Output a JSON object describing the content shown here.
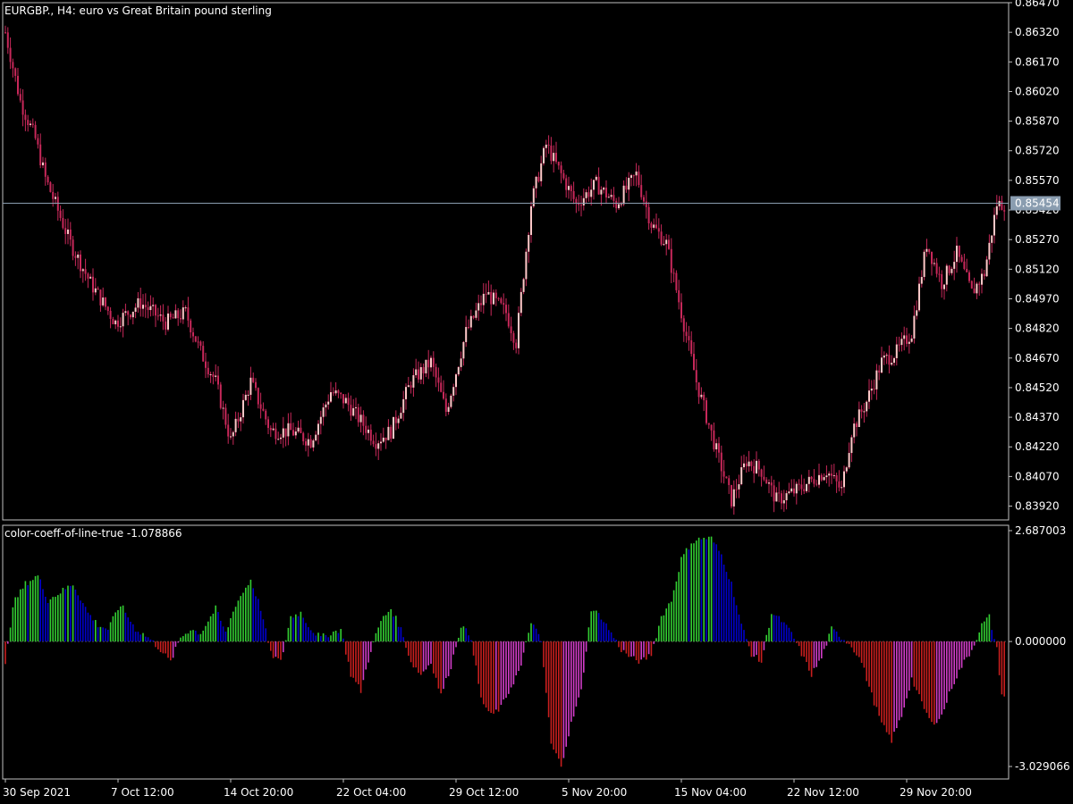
{
  "window": {
    "title": "EURGBP., H4:  euro vs Great Britain pound sterling",
    "indicator_label": "color-coeff-of-line-true -1.078866"
  },
  "colors": {
    "background": "#000000",
    "frame": "#c0c0c0",
    "bull_body": "#ffc8c8",
    "bear_body": "#c8285a",
    "wick": "#c8285a",
    "bid_line": "#8a9db0",
    "bid_label_bg": "#8a9db0",
    "hist_up_strong": "#32cd32",
    "hist_up_weak": "#0000cd",
    "hist_down_strong": "#c81e1e",
    "hist_down_weak": "#d23cc8"
  },
  "chart_data": [
    {
      "type": "candlestick",
      "symbol": "EURGBP.",
      "timeframe": "H4",
      "ylim": [
        0.8385,
        0.8647
      ],
      "y_ticks": [
        "0.86470",
        "0.86320",
        "0.86170",
        "0.86020",
        "0.85870",
        "0.85720",
        "0.85570",
        "0.85420",
        "0.85270",
        "0.85120",
        "0.84970",
        "0.84820",
        "0.84670",
        "0.84520",
        "0.84370",
        "0.84220",
        "0.84070",
        "0.83920"
      ],
      "current_price": "0.85454",
      "current_price_value": 0.85454,
      "close_anchors": [
        [
          0,
          0.8632
        ],
        [
          6,
          0.8597
        ],
        [
          12,
          0.8578
        ],
        [
          16,
          0.8558
        ],
        [
          20,
          0.8545
        ],
        [
          26,
          0.8525
        ],
        [
          34,
          0.8505
        ],
        [
          44,
          0.8485
        ],
        [
          54,
          0.8495
        ],
        [
          64,
          0.8485
        ],
        [
          72,
          0.849
        ],
        [
          78,
          0.847
        ],
        [
          84,
          0.8455
        ],
        [
          90,
          0.8425
        ],
        [
          98,
          0.8455
        ],
        [
          106,
          0.843
        ],
        [
          114,
          0.843
        ],
        [
          122,
          0.8425
        ],
        [
          130,
          0.845
        ],
        [
          136,
          0.8445
        ],
        [
          142,
          0.8435
        ],
        [
          148,
          0.8425
        ],
        [
          154,
          0.843
        ],
        [
          162,
          0.8455
        ],
        [
          170,
          0.8465
        ],
        [
          176,
          0.844
        ],
        [
          184,
          0.848
        ],
        [
          192,
          0.85
        ],
        [
          200,
          0.849
        ],
        [
          204,
          0.8475
        ],
        [
          210,
          0.8545
        ],
        [
          216,
          0.8575
        ],
        [
          222,
          0.856
        ],
        [
          228,
          0.8545
        ],
        [
          236,
          0.8555
        ],
        [
          244,
          0.8545
        ],
        [
          252,
          0.856
        ],
        [
          258,
          0.8535
        ],
        [
          264,
          0.8525
        ],
        [
          270,
          0.849
        ],
        [
          276,
          0.8455
        ],
        [
          284,
          0.842
        ],
        [
          290,
          0.8395
        ],
        [
          296,
          0.8415
        ],
        [
          302,
          0.841
        ],
        [
          308,
          0.8395
        ],
        [
          316,
          0.84
        ],
        [
          322,
          0.8405
        ],
        [
          328,
          0.841
        ],
        [
          334,
          0.84
        ],
        [
          338,
          0.843
        ],
        [
          344,
          0.8445
        ],
        [
          350,
          0.8465
        ],
        [
          356,
          0.847
        ],
        [
          362,
          0.848
        ],
        [
          368,
          0.8525
        ],
        [
          374,
          0.8505
        ],
        [
          380,
          0.852
        ],
        [
          386,
          0.85
        ],
        [
          391,
          0.851
        ],
        [
          396,
          0.8545
        ]
      ]
    },
    {
      "type": "bar",
      "title": "color-coeff-of-line-true -1.078866",
      "ylim": [
        -3.029066,
        2.687003
      ],
      "y_ticks": [
        "2.687003",
        "0.000000",
        "-3.029066"
      ],
      "y_tick_values": [
        2.687003,
        0.0,
        -3.029066
      ],
      "anchors": [
        [
          0,
          -0.6
        ],
        [
          3,
          0.9
        ],
        [
          8,
          1.4
        ],
        [
          13,
          1.6
        ],
        [
          17,
          1.0
        ],
        [
          22,
          1.2
        ],
        [
          27,
          1.4
        ],
        [
          33,
          0.7
        ],
        [
          37,
          0.4
        ],
        [
          41,
          0.3
        ],
        [
          46,
          0.9
        ],
        [
          52,
          0.3
        ],
        [
          57,
          0.1
        ],
        [
          62,
          -0.2
        ],
        [
          66,
          -0.5
        ],
        [
          70,
          0.1
        ],
        [
          74,
          0.3
        ],
        [
          78,
          0.2
        ],
        [
          84,
          0.8
        ],
        [
          88,
          0.2
        ],
        [
          92,
          0.9
        ],
        [
          98,
          1.5
        ],
        [
          102,
          0.8
        ],
        [
          106,
          -0.3
        ],
        [
          110,
          -0.5
        ],
        [
          114,
          0.6
        ],
        [
          118,
          0.7
        ],
        [
          122,
          0.3
        ],
        [
          126,
          0.1
        ],
        [
          130,
          0.2
        ],
        [
          134,
          0.3
        ],
        [
          138,
          -0.8
        ],
        [
          142,
          -1.2
        ],
        [
          146,
          -0.2
        ],
        [
          150,
          0.5
        ],
        [
          154,
          0.8
        ],
        [
          158,
          0.3
        ],
        [
          162,
          -0.5
        ],
        [
          166,
          -0.8
        ],
        [
          170,
          -0.5
        ],
        [
          174,
          -1.3
        ],
        [
          178,
          -0.6
        ],
        [
          182,
          0.4
        ],
        [
          186,
          0.1
        ],
        [
          190,
          -1.4
        ],
        [
          194,
          -1.8
        ],
        [
          198,
          -1.6
        ],
        [
          202,
          -1.1
        ],
        [
          206,
          -0.6
        ],
        [
          210,
          0.5
        ],
        [
          214,
          0.0
        ],
        [
          218,
          -2.5
        ],
        [
          222,
          -3.0
        ],
        [
          226,
          -2.0
        ],
        [
          230,
          -1.2
        ],
        [
          234,
          0.8
        ],
        [
          238,
          0.6
        ],
        [
          242,
          0.2
        ],
        [
          246,
          -0.2
        ],
        [
          250,
          -0.4
        ],
        [
          254,
          -0.5
        ],
        [
          258,
          -0.3
        ],
        [
          262,
          0.6
        ],
        [
          266,
          1.0
        ],
        [
          270,
          2.0
        ],
        [
          274,
          2.4
        ],
        [
          278,
          2.5
        ],
        [
          282,
          2.5
        ],
        [
          286,
          2.1
        ],
        [
          290,
          1.4
        ],
        [
          294,
          0.4
        ],
        [
          298,
          -0.3
        ],
        [
          302,
          -0.5
        ],
        [
          306,
          0.7
        ],
        [
          310,
          0.5
        ],
        [
          314,
          0.2
        ],
        [
          318,
          -0.3
        ],
        [
          322,
          -0.8
        ],
        [
          326,
          -0.4
        ],
        [
          330,
          0.3
        ],
        [
          334,
          0.1
        ],
        [
          338,
          -0.1
        ],
        [
          342,
          -0.5
        ],
        [
          346,
          -1.3
        ],
        [
          350,
          -2.0
        ],
        [
          354,
          -2.4
        ],
        [
          358,
          -1.8
        ],
        [
          362,
          -0.9
        ],
        [
          366,
          -1.5
        ],
        [
          370,
          -2.0
        ],
        [
          374,
          -1.8
        ],
        [
          378,
          -1.1
        ],
        [
          382,
          -0.6
        ],
        [
          386,
          -0.2
        ],
        [
          390,
          0.4
        ],
        [
          393,
          0.6
        ],
        [
          396,
          -0.2
        ],
        [
          398,
          -1.3
        ]
      ]
    }
  ],
  "x_axis": {
    "labels": [
      {
        "text": "30 Sep 2021",
        "bar": 0
      },
      {
        "text": "7 Oct 12:00",
        "bar": 45
      },
      {
        "text": "14 Oct 20:00",
        "bar": 90
      },
      {
        "text": "22 Oct 04:00",
        "bar": 135
      },
      {
        "text": "29 Oct 12:00",
        "bar": 180
      },
      {
        "text": "5 Nov 20:00",
        "bar": 225
      },
      {
        "text": "15 Nov 04:00",
        "bar": 270
      },
      {
        "text": "22 Nov 12:00",
        "bar": 315
      },
      {
        "text": "29 Nov 20:00",
        "bar": 360
      }
    ]
  }
}
